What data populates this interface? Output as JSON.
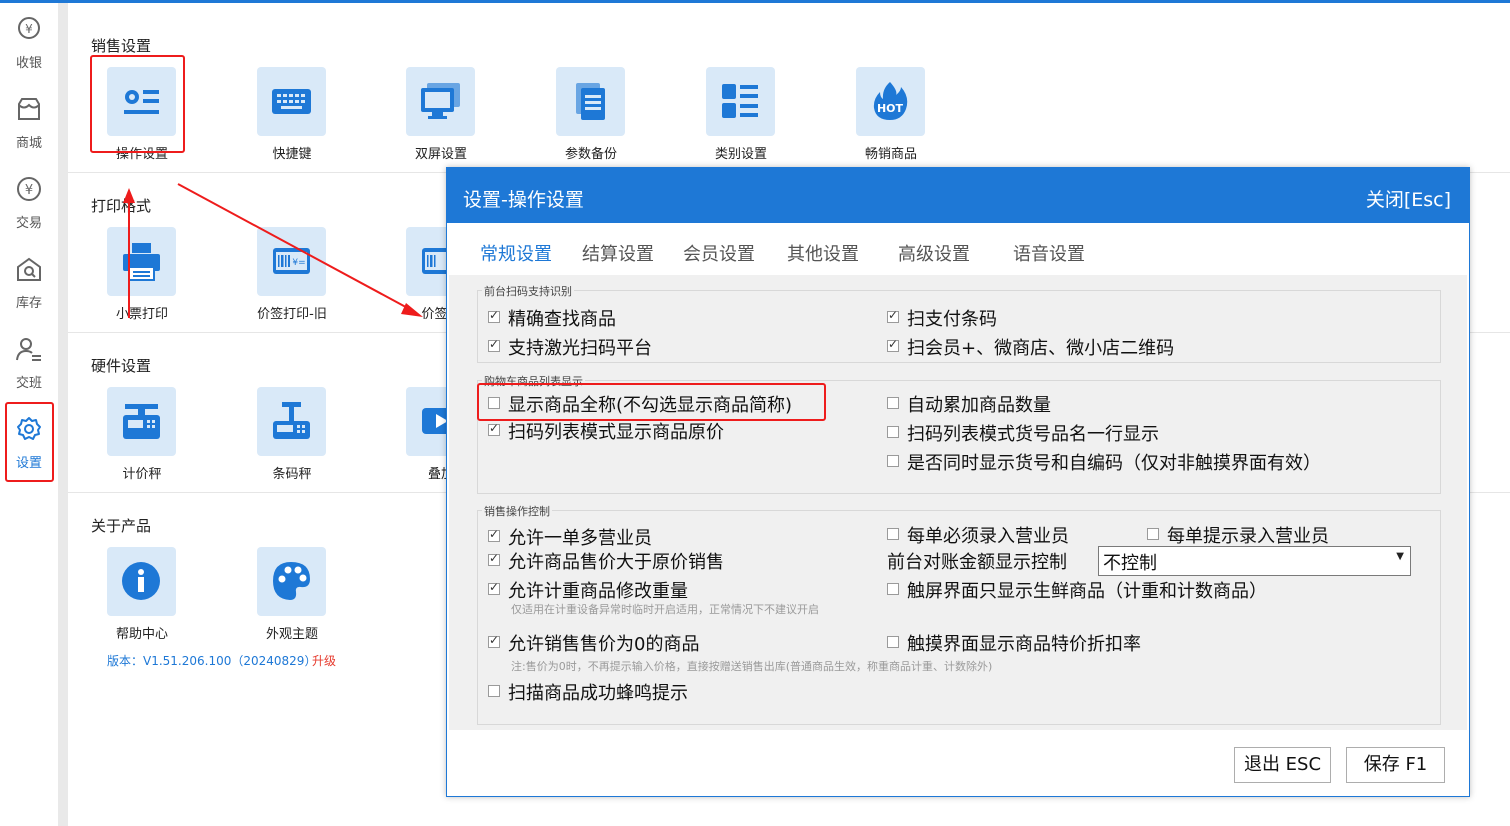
{
  "nav": {
    "items": [
      {
        "label": "收银",
        "icon": "cashier-yen-icon"
      },
      {
        "label": "商城",
        "icon": "shop-icon"
      },
      {
        "label": "交易",
        "icon": "transaction-yen-icon"
      },
      {
        "label": "库存",
        "icon": "inventory-icon"
      },
      {
        "label": "交班",
        "icon": "shift-user-icon"
      },
      {
        "label": "设置",
        "icon": "gear-icon"
      }
    ],
    "active_index": 5
  },
  "sections": {
    "sales": {
      "title": "销售设置",
      "tiles": [
        {
          "label": "操作设置",
          "icon": "operation-settings-icon"
        },
        {
          "label": "快捷键",
          "icon": "keyboard-icon"
        },
        {
          "label": "双屏设置",
          "icon": "dual-screen-icon"
        },
        {
          "label": "参数备份",
          "icon": "document-backup-icon"
        },
        {
          "label": "类别设置",
          "icon": "category-list-icon"
        },
        {
          "label": "畅销商品",
          "icon": "hot-fire-icon"
        }
      ]
    },
    "print": {
      "title": "打印格式",
      "tiles": [
        {
          "label": "小票打印",
          "icon": "receipt-printer-icon"
        },
        {
          "label": "价签打印-旧",
          "icon": "price-tag-icon"
        },
        {
          "label": "价签打",
          "icon": "price-tag-icon"
        }
      ]
    },
    "hardware": {
      "title": "硬件设置",
      "tiles": [
        {
          "label": "计价秤",
          "icon": "pricing-scale-icon"
        },
        {
          "label": "条码秤",
          "icon": "barcode-scale-icon"
        },
        {
          "label": "叠加",
          "icon": "video-overlay-icon"
        }
      ]
    },
    "about": {
      "title": "关于产品",
      "tiles": [
        {
          "label": "帮助中心",
          "icon": "info-icon"
        },
        {
          "label": "外观主题",
          "icon": "palette-icon"
        }
      ],
      "version": "版本：V1.51.206.100（20240829）",
      "upgrade": "升级"
    }
  },
  "dialog": {
    "title": "设置-操作设置",
    "close": "关闭[Esc]",
    "tabs": [
      "常规设置",
      "结算设置",
      "会员设置",
      "其他设置",
      "高级设置",
      "语音设置"
    ],
    "active_tab": 0,
    "groups": {
      "scan": {
        "title": "前台扫码支持识别",
        "options": [
          {
            "label": "精确查找商品",
            "checked": true
          },
          {
            "label": "扫支付条码",
            "checked": true
          },
          {
            "label": "支持激光扫码平台",
            "checked": true
          },
          {
            "label": "扫会员+、微商店、微小店二维码",
            "checked": true
          }
        ]
      },
      "cart": {
        "title": "购物车商品列表显示",
        "options": [
          {
            "label": "显示商品全称(不勾选显示商品简称)",
            "checked": false
          },
          {
            "label": "自动累加商品数量",
            "checked": false
          },
          {
            "label": "扫码列表模式显示商品原价",
            "checked": true
          },
          {
            "label": "扫码列表模式货号品名一行显示",
            "checked": false
          },
          {
            "label": "是否同时显示货号和自编码（仅对非触摸界面有效）",
            "checked": false
          }
        ]
      },
      "control": {
        "title": "销售操作控制",
        "options": [
          {
            "label": "允许一单多营业员",
            "checked": true
          },
          {
            "label": "每单必须录入营业员",
            "checked": false
          },
          {
            "label": "每单提示录入营业员",
            "checked": false
          },
          {
            "label": "允许商品售价大于原价销售",
            "checked": true
          },
          {
            "label": "允许计重商品修改重量",
            "checked": true
          },
          {
            "label": "触屏界面只显示生鲜商品（计重和计数商品）",
            "checked": false
          },
          {
            "label": "允许销售售价为0的商品",
            "checked": true
          },
          {
            "label": "触摸界面显示商品特价折扣率",
            "checked": false
          },
          {
            "label": "扫描商品成功蜂鸣提示",
            "checked": false
          }
        ],
        "amount_label": "前台对账金额显示控制",
        "amount_value": "不控制",
        "note_weight": "仅适用在计重设备异常时临时开启适用，正常情况下不建议开启",
        "note_zero": "注:售价为0时，不再提示输入价格，直接按赠送销售出库(普通商品生效，称重商品计重、计数除外)"
      }
    },
    "buttons": {
      "exit": "退出 ESC",
      "save": "保存 F1"
    }
  },
  "colors": {
    "accent": "#1E78D6",
    "tile_bg": "#D9E9F8",
    "annotation": "#EE1C1C"
  }
}
